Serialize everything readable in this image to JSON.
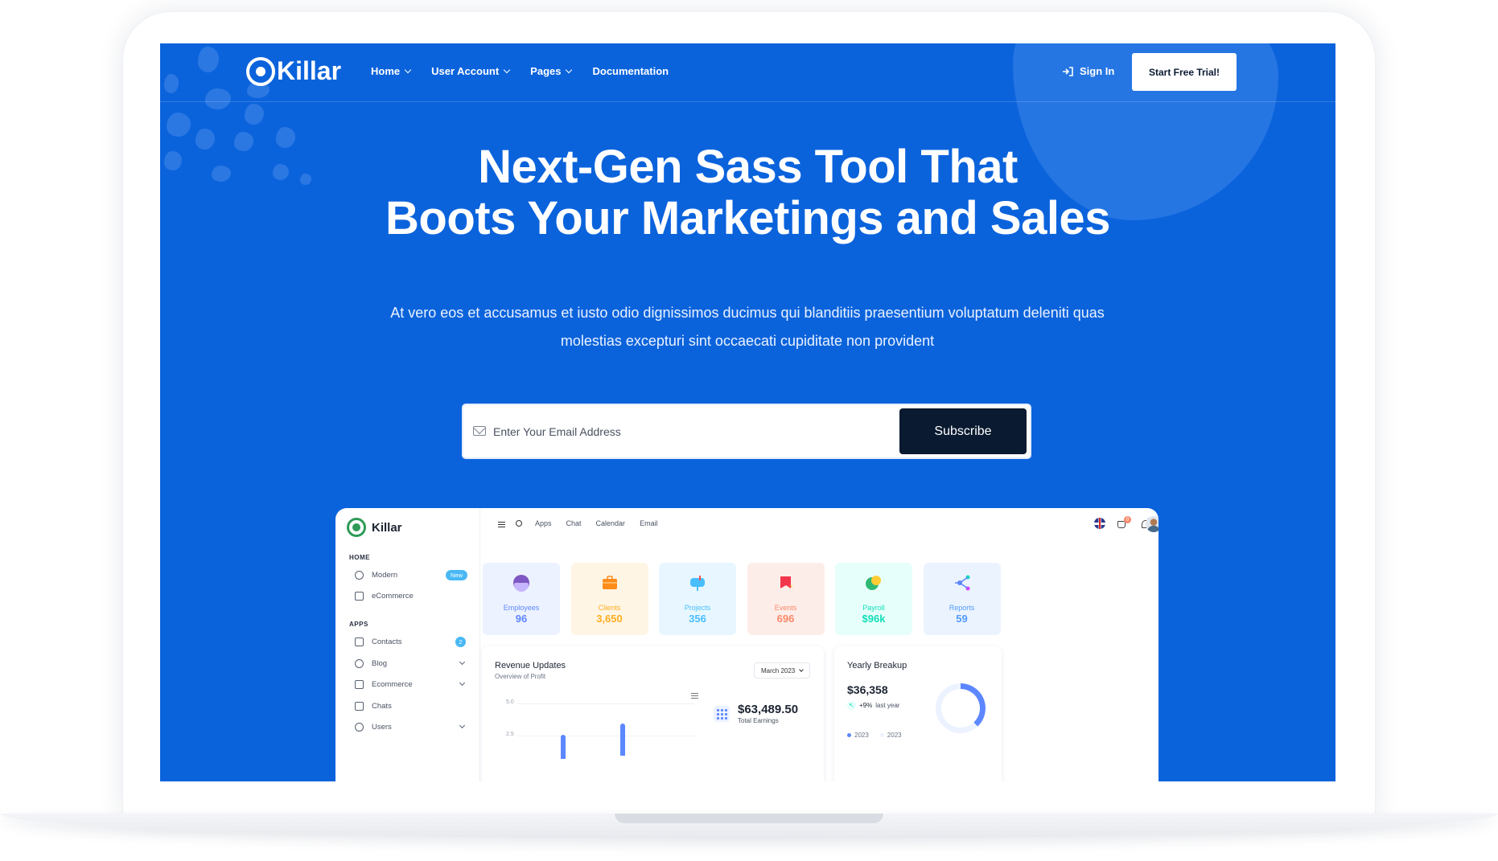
{
  "brand": {
    "name": "Killar"
  },
  "nav": {
    "items": [
      {
        "label": "Home",
        "has_dropdown": true
      },
      {
        "label": "User Account",
        "has_dropdown": true
      },
      {
        "label": "Pages",
        "has_dropdown": true
      },
      {
        "label": "Documentation",
        "has_dropdown": false
      }
    ],
    "sign_in": "Sign In",
    "cta": "Start Free Trial!"
  },
  "hero": {
    "title_line1": "Next-Gen Sass Tool That",
    "title_line2": "Boots Your Marketings and Sales",
    "subtitle_line1": "At vero eos et accusamus et iusto odio dignissimos ducimus qui blanditiis praesentium voluptatum deleniti quas",
    "subtitle_line2": "molestias excepturi sint occaecati cupiditate non provident",
    "email_placeholder": "Enter Your Email Address",
    "subscribe_label": "Subscribe"
  },
  "dashboard": {
    "brand": "Killar",
    "sidebar": {
      "home_heading": "HOME",
      "home_items": [
        {
          "label": "Modern",
          "badge": "New"
        },
        {
          "label": "eCommerce"
        }
      ],
      "apps_heading": "APPS",
      "app_items": [
        {
          "label": "Contacts",
          "badge": "2"
        },
        {
          "label": "Blog"
        },
        {
          "label": "Ecommerce"
        },
        {
          "label": "Chats"
        },
        {
          "label": "Users"
        }
      ]
    },
    "topbar": {
      "links": [
        "Apps",
        "Chat",
        "Calendar",
        "Email"
      ],
      "cart_count": "0"
    },
    "stats": [
      {
        "label": "Employees",
        "value": "96",
        "bg": "#ecf2ff",
        "color": "#5d87ff",
        "icon": "employee-icon"
      },
      {
        "label": "Clients",
        "value": "3,650",
        "bg": "#fef5e5",
        "color": "#ffae1f",
        "icon": "briefcase-icon"
      },
      {
        "label": "Projects",
        "value": "356",
        "bg": "#e8f7ff",
        "color": "#49beff",
        "icon": "mailbox-icon"
      },
      {
        "label": "Events",
        "value": "696",
        "bg": "#fdede8",
        "color": "#fa896b",
        "icon": "flag-icon"
      },
      {
        "label": "Payroll",
        "value": "$96k",
        "bg": "#e6fffa",
        "color": "#13deb9",
        "icon": "chat-bubble-icon"
      },
      {
        "label": "Reports",
        "value": "59",
        "bg": "#ebf3fe",
        "color": "#539bff",
        "icon": "connect-icon"
      }
    ],
    "revenue": {
      "title": "Revenue Updates",
      "subtitle": "Overview of Profit",
      "month": "March 2023",
      "y_ticks": [
        "5.0",
        "2.5"
      ],
      "total_value": "$63,489.50",
      "total_label": "Total Earnings"
    },
    "yearly": {
      "title": "Yearly Breakup",
      "value": "$36,358",
      "change": "+9%",
      "change_label": "last year",
      "legend": [
        "2023",
        "2023"
      ]
    }
  }
}
